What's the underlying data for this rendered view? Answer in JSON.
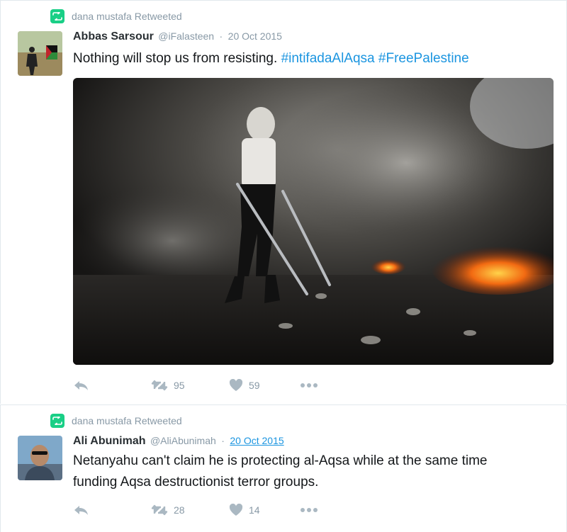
{
  "tweets": [
    {
      "retweeted_by": "dana mustafa Retweeted",
      "fullname": "Abbas Sarsour",
      "screen_name": "@iFalasteen",
      "separator": "·",
      "time": "20 Oct 2015",
      "text_plain": "Nothing will stop us from resisting. ",
      "hashtags": [
        "#intifadaAlAqsa",
        "#FreePalestine"
      ],
      "retweet_count": "95",
      "like_count": "59",
      "avatar_icon": "avatar-photo",
      "media_icon": "protest-photo"
    },
    {
      "retweeted_by": "dana mustafa Retweeted",
      "fullname": "Ali Abunimah",
      "screen_name": "@AliAbunimah",
      "separator": "·",
      "time": "20 Oct 2015",
      "text_line1": "Netanyahu can't claim he is protecting al-Aqsa while at the same time",
      "text_line2": "funding Aqsa destructionist terror groups.",
      "retweet_count": "28",
      "like_count": "14",
      "avatar_icon": "avatar-photo"
    }
  ],
  "colors": {
    "accent": "#1b95e0",
    "retweet_green": "#19cf86",
    "muted": "#8899a6",
    "action_icon": "#aab8c2"
  }
}
